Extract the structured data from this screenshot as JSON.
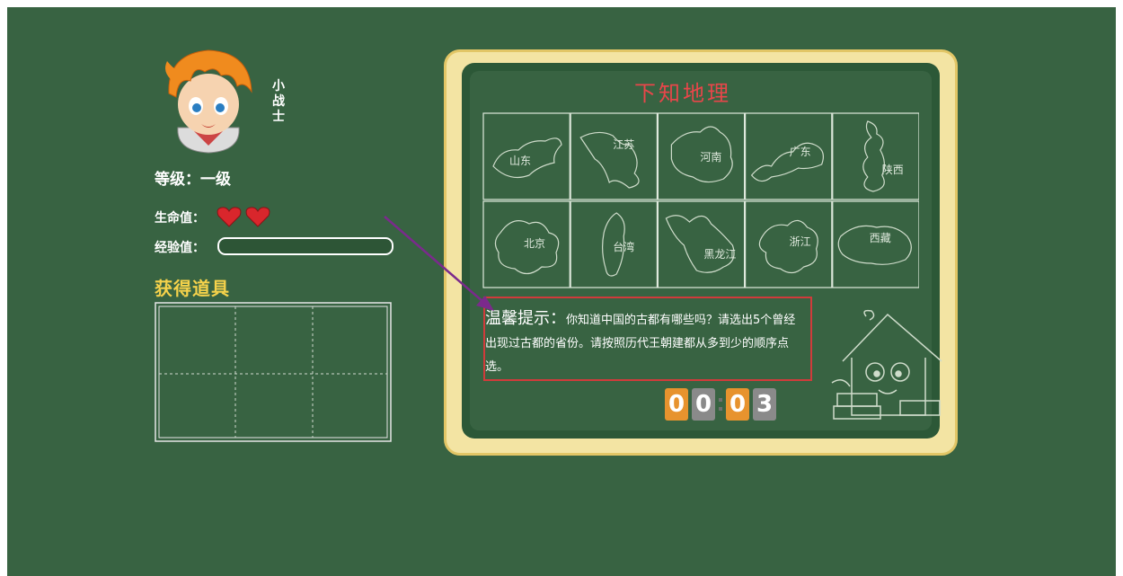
{
  "player": {
    "name": "小战士",
    "level": "等级：一级",
    "hp_label": "生命值：",
    "hearts": 2,
    "xp_label": "经验值：",
    "xp_progress": 0,
    "items_title": "获得道具"
  },
  "board": {
    "title": "下知地理",
    "provinces": [
      {
        "label": "山东"
      },
      {
        "label": "江苏"
      },
      {
        "label": "河南"
      },
      {
        "label": "广东"
      },
      {
        "label": "陕西"
      },
      {
        "label": "北京"
      },
      {
        "label": "台湾"
      },
      {
        "label": "黑龙江"
      },
      {
        "label": "浙江"
      },
      {
        "label": "西藏"
      }
    ],
    "hint_title": "温馨提示：",
    "hint_text": "你知道中国的古都有哪些吗？请选出5个曾经出现过古都的省份。请按照历代王朝建都从多到少的顺序点选。",
    "timer": [
      "0",
      "0",
      "0",
      "3"
    ]
  },
  "colors": {
    "background": "#386342",
    "title_red": "#e8464a",
    "items_title": "#f5d24b",
    "hint_border": "#d13b3b",
    "digit_orange": "#e7932e",
    "digit_grey": "#8a8a8a",
    "arrow": "#7b2a8c"
  },
  "icons": [
    "avatar-boy",
    "heart-icon",
    "house-mascot",
    "pointer-arrow"
  ]
}
